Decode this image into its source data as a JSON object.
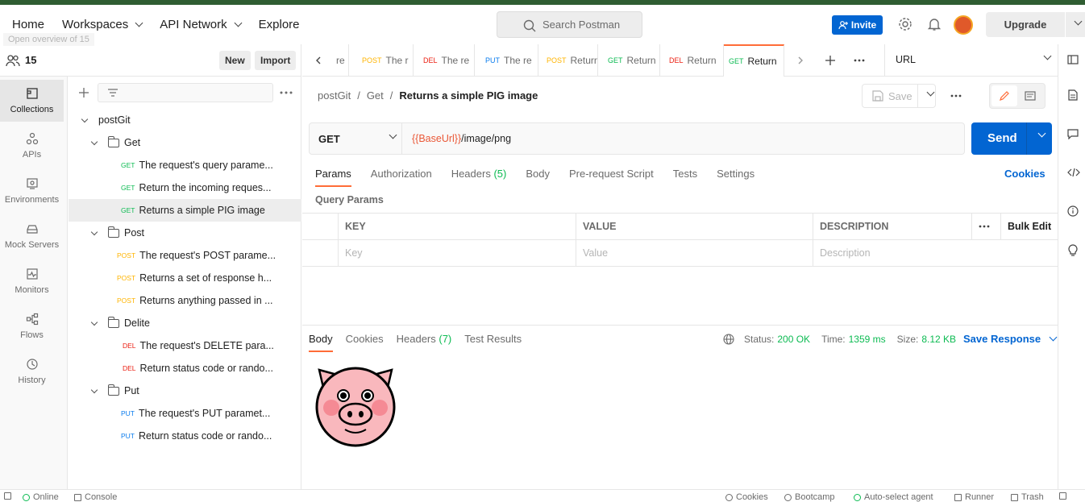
{
  "header": {
    "nav": [
      {
        "label": "Home"
      },
      {
        "label": "Workspaces"
      },
      {
        "label": "API Network"
      },
      {
        "label": "Explore"
      }
    ],
    "tooltip": "Open overview of 15",
    "search_placeholder": "Search Postman",
    "invite_label": "Invite",
    "upgrade_label": "Upgrade"
  },
  "workspace": {
    "count": "15",
    "new_label": "New",
    "import_label": "Import"
  },
  "rail": [
    {
      "label": "Collections",
      "icon": "collections-icon"
    },
    {
      "label": "APIs",
      "icon": "apis-icon"
    },
    {
      "label": "Environments",
      "icon": "environments-icon"
    },
    {
      "label": "Mock Servers",
      "icon": "mock-servers-icon"
    },
    {
      "label": "Monitors",
      "icon": "monitors-icon"
    },
    {
      "label": "Flows",
      "icon": "flows-icon"
    },
    {
      "label": "History",
      "icon": "history-icon"
    }
  ],
  "tree": {
    "collection": "postGit",
    "folders": [
      {
        "name": "Get",
        "items": [
          {
            "method": "GET",
            "label": "The request's query parame..."
          },
          {
            "method": "GET",
            "label": "Return the incoming reques..."
          },
          {
            "method": "GET",
            "label": "Returns a simple PIG image"
          }
        ]
      },
      {
        "name": "Post",
        "items": [
          {
            "method": "POST",
            "label": "The request's POST parame..."
          },
          {
            "method": "POST",
            "label": "Returns a set of response h..."
          },
          {
            "method": "POST",
            "label": "Returns anything passed in ..."
          }
        ]
      },
      {
        "name": "Delite",
        "items": [
          {
            "method": "DEL",
            "label": "The request's DELETE para..."
          },
          {
            "method": "DEL",
            "label": "Return status code or rando..."
          }
        ]
      },
      {
        "name": "Put",
        "items": [
          {
            "method": "PUT",
            "label": "The request's PUT paramet..."
          },
          {
            "method": "PUT",
            "label": "Return status code or rando..."
          }
        ]
      }
    ]
  },
  "tabs": [
    {
      "method": "",
      "label": "re"
    },
    {
      "method": "POST",
      "label": "The r"
    },
    {
      "method": "DEL",
      "label": "The re"
    },
    {
      "method": "PUT",
      "label": "The re"
    },
    {
      "method": "POST",
      "label": "Return"
    },
    {
      "method": "GET",
      "label": "Return"
    },
    {
      "method": "DEL",
      "label": "Return"
    },
    {
      "method": "GET",
      "label": "Return"
    }
  ],
  "environment_label": "URL",
  "breadcrumb": {
    "collection": "postGit",
    "folder": "Get",
    "request": "Returns a simple PIG image",
    "sep": "/"
  },
  "save_label": "Save",
  "request": {
    "method": "GET",
    "url_var": "{{BaseUrl}}",
    "url_path": "/image/png",
    "send_label": "Send",
    "tabs": [
      {
        "label": "Params",
        "count": ""
      },
      {
        "label": "Authorization",
        "count": ""
      },
      {
        "label": "Headers",
        "count": "(5)"
      },
      {
        "label": "Body",
        "count": ""
      },
      {
        "label": "Pre-request Script",
        "count": ""
      },
      {
        "label": "Tests",
        "count": ""
      },
      {
        "label": "Settings",
        "count": ""
      }
    ],
    "cookies_label": "Cookies",
    "query_params_title": "Query Params",
    "table": {
      "headers": [
        "KEY",
        "VALUE",
        "DESCRIPTION"
      ],
      "placeholders": [
        "Key",
        "Value",
        "Description"
      ],
      "bulk_edit": "Bulk Edit"
    }
  },
  "response": {
    "tabs": [
      {
        "label": "Body",
        "count": ""
      },
      {
        "label": "Cookies",
        "count": ""
      },
      {
        "label": "Headers",
        "count": "(7)"
      },
      {
        "label": "Test Results",
        "count": ""
      }
    ],
    "status_label": "Status:",
    "status_value": "200 OK",
    "time_label": "Time:",
    "time_value": "1359 ms",
    "size_label": "Size:",
    "size_value": "8.12 KB",
    "save_label": "Save Response"
  },
  "footer": {
    "online": "Online",
    "console": "Console",
    "cookies": "Cookies",
    "bootcamp": "Bootcamp",
    "agent": "Auto-select agent",
    "runner": "Runner",
    "trash": "Trash"
  },
  "colors": {
    "accent": "#ff6c37",
    "primary": "#0265d2",
    "get": "#0cbb52",
    "post": "#ffb400",
    "del": "#eb2013",
    "put": "#097bed"
  }
}
